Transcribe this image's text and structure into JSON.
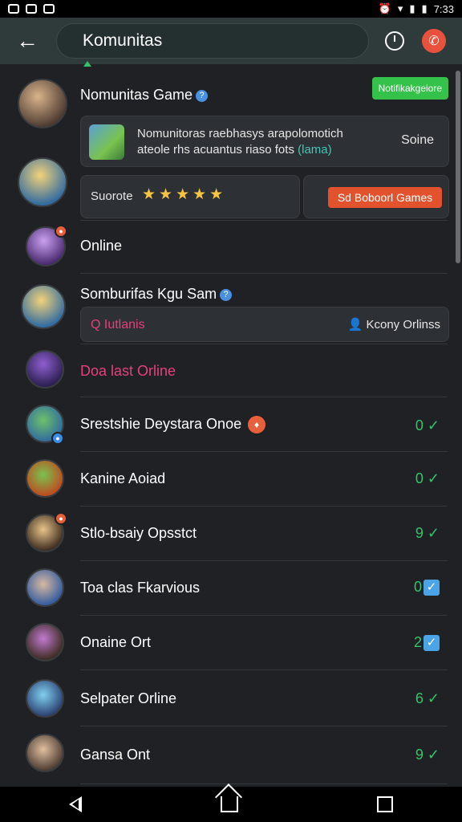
{
  "status_bar": {
    "time": "7:33"
  },
  "app_bar": {
    "search_value": "Komunitas"
  },
  "featured": {
    "title": "Nomunitas Game",
    "pill": "Notifikakgeiore",
    "card1": {
      "line1": "Nomunitoras raebhasys arapolomotich",
      "line2_a": "ateole rhs acuantus riaso fots ",
      "line2_b": "(lama)",
      "action": "Soine"
    },
    "rating_label": "Suorote",
    "stars": "★★★★★",
    "button": "Sd Boboorl Games"
  },
  "rows": [
    {
      "title": "Online"
    },
    {
      "title": "Somburifas Kgu Sam",
      "sub_left": "Q Iutlanis",
      "sub_right": "Kcony Orlinss"
    },
    {
      "title": "Doa last Orline"
    },
    {
      "title": "Srestshie Deystara Onoe",
      "count": "0",
      "mark": "✓"
    },
    {
      "title": "Kanine Aoiad",
      "count": "0",
      "mark": "✓"
    },
    {
      "title": "Stlo-bsaiy Opsstct",
      "count": "9",
      "mark": "✓"
    },
    {
      "title": "Toa clas Fkarvious",
      "count": "0",
      "mark": "✓"
    },
    {
      "title": "Onaine Ort",
      "count": "2",
      "mark": "✓"
    },
    {
      "title": "Selpater Orline",
      "count": "6",
      "mark": "✓"
    },
    {
      "title": "Gansa Ont",
      "count": "9",
      "mark": "✓"
    }
  ]
}
